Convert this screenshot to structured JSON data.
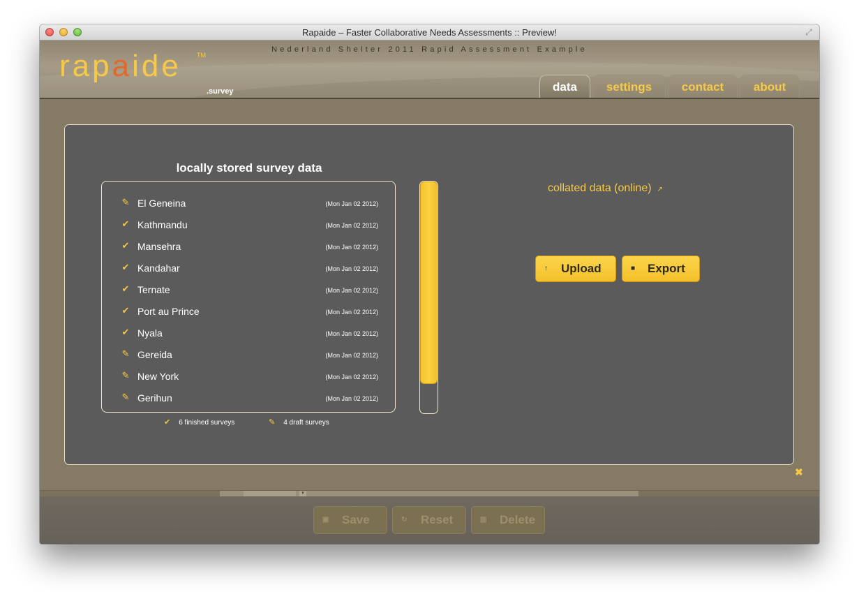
{
  "window": {
    "title": "Rapaide – Faster Collaborative Needs Assessments :: Preview!"
  },
  "header": {
    "subtitle": "Nederland Shelter 2011 Rapid Assessment Example",
    "logo_pre": "rap",
    "logo_mid": "a",
    "logo_post": "ide",
    "logo_tm": "TM",
    "logo_suffix": ".survey",
    "tabs": [
      {
        "label": "data",
        "active": true
      },
      {
        "label": "settings",
        "active": false
      },
      {
        "label": "contact",
        "active": false
      },
      {
        "label": "about",
        "active": false
      }
    ]
  },
  "local": {
    "title": "locally stored survey data",
    "surveys": [
      {
        "name": "El Geneina",
        "date": "(Mon Jan 02 2012)",
        "status": "draft"
      },
      {
        "name": "Kathmandu",
        "date": "(Mon Jan 02 2012)",
        "status": "finished"
      },
      {
        "name": "Mansehra",
        "date": "(Mon Jan 02 2012)",
        "status": "finished"
      },
      {
        "name": "Kandahar",
        "date": "(Mon Jan 02 2012)",
        "status": "finished"
      },
      {
        "name": "Ternate",
        "date": "(Mon Jan 02 2012)",
        "status": "finished"
      },
      {
        "name": "Port au Prince",
        "date": "(Mon Jan 02 2012)",
        "status": "finished"
      },
      {
        "name": "Nyala",
        "date": "(Mon Jan 02 2012)",
        "status": "finished"
      },
      {
        "name": "Gereida",
        "date": "(Mon Jan 02 2012)",
        "status": "draft"
      },
      {
        "name": "New York",
        "date": "(Mon Jan 02 2012)",
        "status": "draft"
      },
      {
        "name": "Gerihun",
        "date": "(Mon Jan 02 2012)",
        "status": "draft"
      }
    ],
    "legend_finished": "6 finished surveys",
    "legend_draft": "4 draft surveys"
  },
  "online": {
    "title": "collated data (online)",
    "upload_label": "Upload",
    "export_label": "Export"
  },
  "footer": {
    "save_label": "Save",
    "reset_label": "Reset",
    "delete_label": "Delete"
  },
  "colors": {
    "accent": "#f7c947",
    "panel": "#5b5b5b",
    "chrome": "#857a63"
  },
  "icons": {
    "finished": "check-icon",
    "draft": "pencil-icon"
  }
}
